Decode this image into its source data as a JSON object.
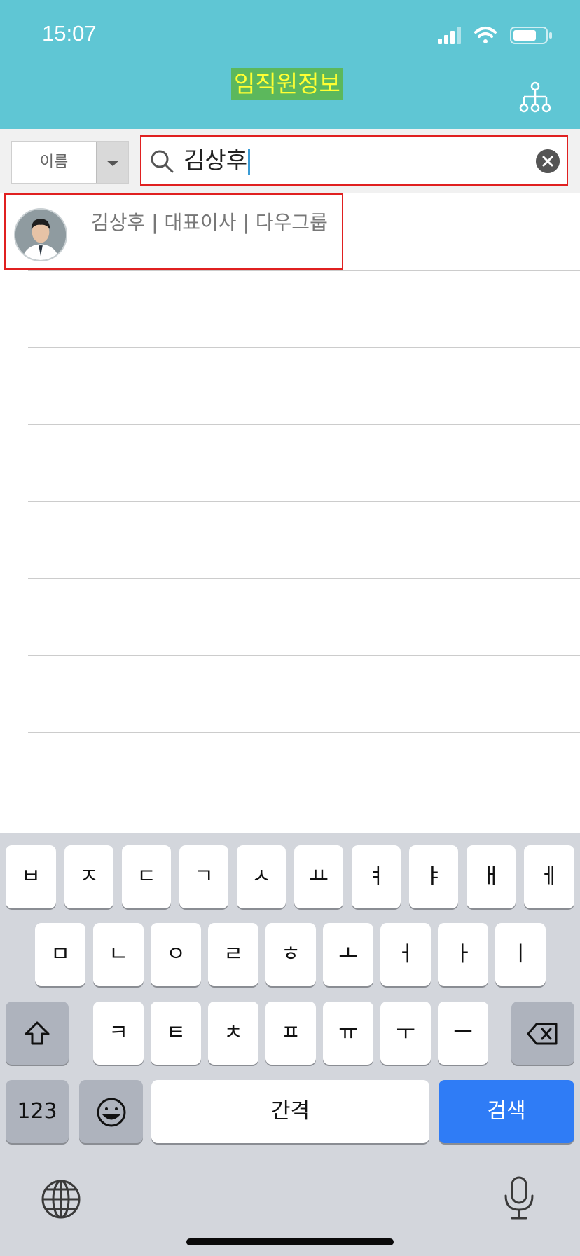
{
  "status": {
    "time": "15:07"
  },
  "header": {
    "title": "임직원정보"
  },
  "search": {
    "filter_label": "이름",
    "query": "김상후"
  },
  "results": [
    {
      "text": "김상후 | 대표이사 | 다우그룹"
    }
  ],
  "keyboard": {
    "row1": [
      "ㅂ",
      "ㅈ",
      "ㄷ",
      "ㄱ",
      "ㅅ",
      "ㅛ",
      "ㅕ",
      "ㅑ",
      "ㅐ",
      "ㅔ"
    ],
    "row2": [
      "ㅁ",
      "ㄴ",
      "ㅇ",
      "ㄹ",
      "ㅎ",
      "ㅗ",
      "ㅓ",
      "ㅏ",
      "ㅣ"
    ],
    "row3": [
      "ㅋ",
      "ㅌ",
      "ㅊ",
      "ㅍ",
      "ㅠ",
      "ㅜ",
      "ㅡ"
    ],
    "numbers_label": "123",
    "space_label": "간격",
    "search_label": "검색"
  },
  "colors": {
    "header": "#5fc6d4",
    "title_bg": "#5cb85c",
    "title_text": "#ffff33",
    "highlight": "#e02020",
    "search_key": "#2f7cf6"
  }
}
